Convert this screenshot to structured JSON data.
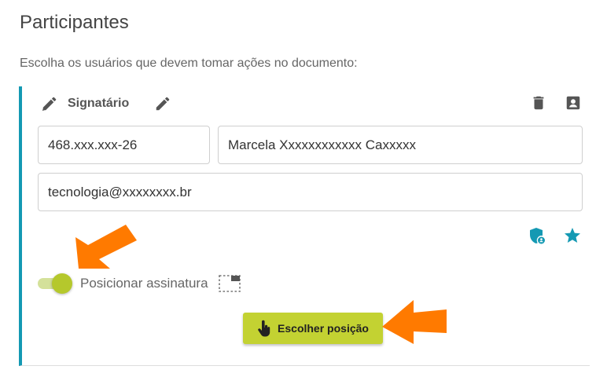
{
  "section": {
    "title": "Participantes",
    "subtitle": "Escolha os usuários que devem tomar ações no documento:"
  },
  "participant": {
    "role": "Signatário",
    "cpf": "468.xxx.xxx-26",
    "name": "Marcela Xxxxxxxxxxxx  Caxxxxx",
    "email": "tecnologia@xxxxxxxx.br"
  },
  "signature_position": {
    "toggle_on": true,
    "label": "Posicionar assinatura",
    "button_label": "Escolher posição"
  },
  "icons": {
    "role_icon": "pen-icon",
    "edit": "pencil-icon",
    "delete": "trash-icon",
    "contact": "contact-card-icon",
    "security": "shield-user-icon",
    "favorite": "star-icon",
    "position": "dashed-frame-icon",
    "button": "hand-pointer-icon"
  },
  "colors": {
    "accent": "#1499b3",
    "teal_icon": "#1499b3",
    "button": "#c3d232",
    "toggle": "#b5c82c",
    "annotation_arrow": "#ff7a00"
  }
}
